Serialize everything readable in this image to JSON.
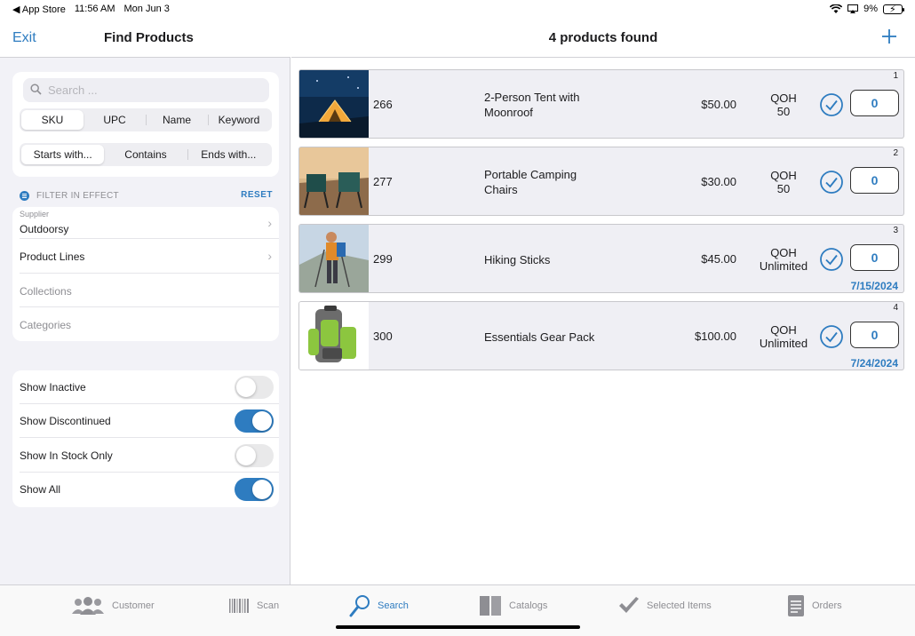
{
  "status_bar": {
    "back_app": "◀ App Store",
    "time": "11:56 AM",
    "date": "Mon Jun 3",
    "battery": "9%"
  },
  "left": {
    "exit_label": "Exit",
    "title": "Find Products",
    "search_placeholder": "Search ...",
    "search_fields": [
      "SKU",
      "UPC",
      "Name",
      "Keyword"
    ],
    "search_field_selected": "SKU",
    "match_modes": [
      "Starts with...",
      "Contains",
      "Ends with..."
    ],
    "match_mode_selected": "Starts with...",
    "filter_label": "FILTER IN EFFECT",
    "reset_label": "RESET",
    "filters": [
      {
        "small": "Supplier",
        "value": "Outdoorsy"
      },
      {
        "value": "Product Lines"
      },
      {
        "value": "Collections"
      },
      {
        "value": "Categories"
      }
    ],
    "toggles": [
      {
        "label": "Show Inactive",
        "on": false
      },
      {
        "label": "Show Discontinued",
        "on": true
      },
      {
        "label": "Show In Stock Only",
        "on": false
      },
      {
        "label": "Show All",
        "on": true
      }
    ]
  },
  "results": {
    "title": "4 products found",
    "items": [
      {
        "index": "1",
        "sku": "266",
        "name": "2-Person Tent with Moonroof",
        "price": "$50.00",
        "qoh_label": "QOH",
        "qoh": "50",
        "qty": "0",
        "date": ""
      },
      {
        "index": "2",
        "sku": "277",
        "name": "Portable Camping Chairs",
        "price": "$30.00",
        "qoh_label": "QOH",
        "qoh": "50",
        "qty": "0",
        "date": ""
      },
      {
        "index": "3",
        "sku": "299",
        "name": "Hiking Sticks",
        "price": "$45.00",
        "qoh_label": "QOH",
        "qoh": "Unlimited",
        "qty": "0",
        "date": "7/15/2024"
      },
      {
        "index": "4",
        "sku": "300",
        "name": "Essentials Gear Pack",
        "price": "$100.00",
        "qoh_label": "QOH",
        "qoh": "Unlimited",
        "qty": "0",
        "date": "7/24/2024"
      }
    ]
  },
  "tabs": [
    {
      "label": "Customer",
      "icon": "people-icon"
    },
    {
      "label": "Scan",
      "icon": "barcode-icon"
    },
    {
      "label": "Search",
      "icon": "search-icon",
      "active": true
    },
    {
      "label": "Catalogs",
      "icon": "catalog-icon"
    },
    {
      "label": "Selected Items",
      "icon": "checkmark-icon"
    },
    {
      "label": "Orders",
      "icon": "document-icon"
    }
  ],
  "colors": {
    "accent": "#2e7cc0",
    "card_bg": "#efeff4",
    "panel_bg": "#f2f2f7"
  }
}
